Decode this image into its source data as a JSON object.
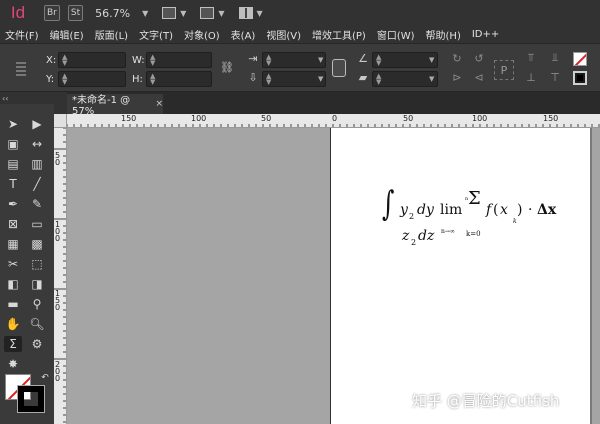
{
  "titlebar": {
    "app_logo": "Id",
    "bridge_button": "Br",
    "stock_button": "St",
    "zoom": "56.7%"
  },
  "menubar": {
    "items": [
      "文件(F)",
      "编辑(E)",
      "版面(L)",
      "文字(T)",
      "对象(O)",
      "表(A)",
      "视图(V)",
      "增效工具(P)",
      "窗口(W)",
      "帮助(H)",
      "ID++"
    ]
  },
  "control": {
    "x_label": "X:",
    "y_label": "Y:",
    "w_label": "W:",
    "h_label": "H:"
  },
  "document": {
    "tab_title": "*未命名-1 @ 57%",
    "tab_close": "×"
  },
  "rulers": {
    "top": [
      "150",
      "100",
      "50",
      "0",
      "50",
      "100",
      "150"
    ],
    "left": [
      "50",
      "100",
      "150",
      "200"
    ]
  },
  "equation": {
    "integral": "∫",
    "y2": "y",
    "y2_sub": "2",
    "dy": "dy",
    "lim": "lim",
    "lim_sub": "n→∞",
    "sum": "Σ",
    "sum_sup": "n",
    "sum_sub": "k=0",
    "f": "f",
    "paren_open": "(",
    "xk": "x",
    "xk_sub": "k",
    "paren_close": ")",
    "dot": "·",
    "delta_x": "Δx",
    "z2": "z",
    "z2_sub": "2",
    "dz": "dz"
  },
  "watermark": "知乎 @冒险的Cutfish",
  "colors": {
    "app_accent": "#e0457b",
    "ui_dark": "#323232",
    "pasteboard": "#a5a5a5",
    "page": "#ffffff"
  }
}
